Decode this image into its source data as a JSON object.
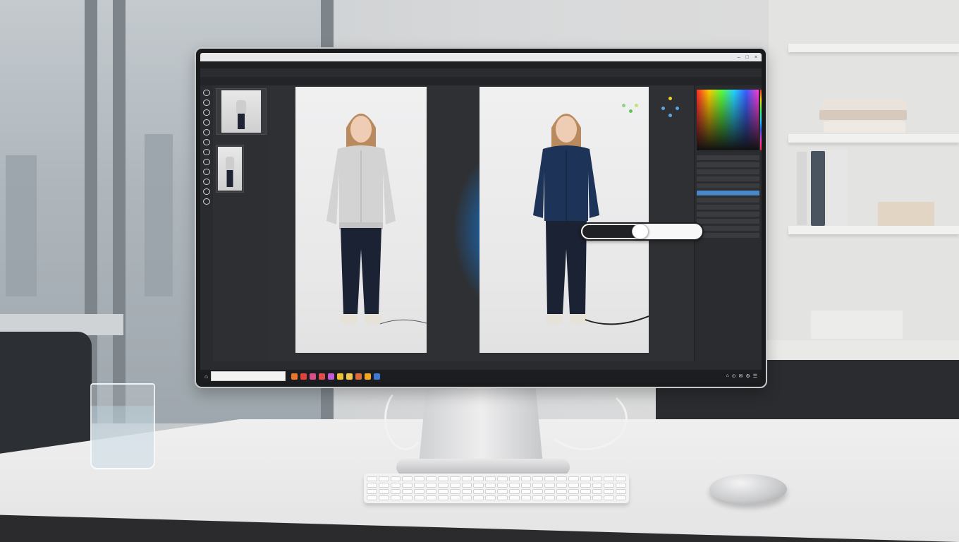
{
  "app": {
    "title": "",
    "menu": [],
    "options": [],
    "tabs": [],
    "status": []
  },
  "panels": {
    "right_tabs": [],
    "layers": [],
    "layer_headers": []
  },
  "thumbnails": [
    {
      "label": ""
    },
    {
      "label": ""
    }
  ],
  "comparison_slider": {
    "value_fraction": 0.49
  },
  "taskbar": {
    "search_placeholder": "",
    "pinned_icon_colors": [
      "#e8762b",
      "#e0433b",
      "#d94f8a",
      "#e14c4c",
      "#c85ad6",
      "#f0c231",
      "#f1c84b",
      "#e06b3a",
      "#f4a623",
      "#3d7ad6"
    ],
    "tray": [
      "⌂",
      "⊙",
      "✉",
      "⚙",
      "☰"
    ]
  },
  "colors": {
    "accent": "#4a87c9",
    "sweater_left": "#d3d3d3",
    "sweater_right": "#1e3358",
    "pants": "#1b2234"
  }
}
